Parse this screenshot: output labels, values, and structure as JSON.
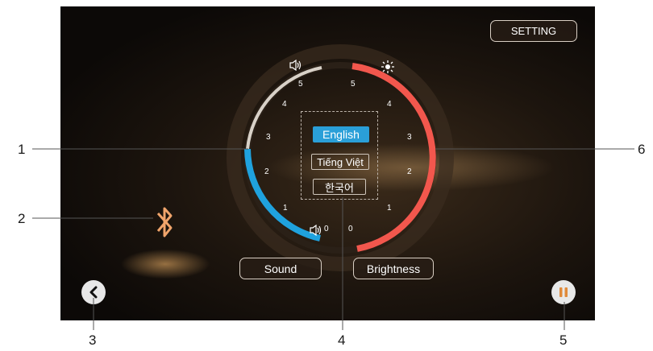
{
  "header": {
    "setting_label": "SETTING"
  },
  "buttons": {
    "sound_label": "Sound",
    "brightness_label": "Brightness"
  },
  "languages": {
    "items": [
      {
        "label": "English",
        "selected": true
      },
      {
        "label": "Tiếng Việt",
        "selected": false
      },
      {
        "label": "한국어",
        "selected": false
      }
    ]
  },
  "sound_scale": {
    "ticks": [
      "0",
      "1",
      "2",
      "3",
      "4",
      "5"
    ],
    "level": 3,
    "max": 5,
    "color": "#1fa2de"
  },
  "brightness_scale": {
    "ticks": [
      "0",
      "1",
      "2",
      "3",
      "4",
      "5"
    ],
    "level": 5,
    "max": 5,
    "color": "#f2574d"
  },
  "callouts": [
    "1",
    "2",
    "3",
    "4",
    "5",
    "6"
  ],
  "colors": {
    "accent_blue": "#2a9fd8",
    "accent_red": "#f2574d",
    "background": "#16100b"
  },
  "icons": [
    "bluetooth-icon",
    "back-arrow-icon",
    "pause-icon",
    "speaker-icon",
    "sun-icon"
  ]
}
